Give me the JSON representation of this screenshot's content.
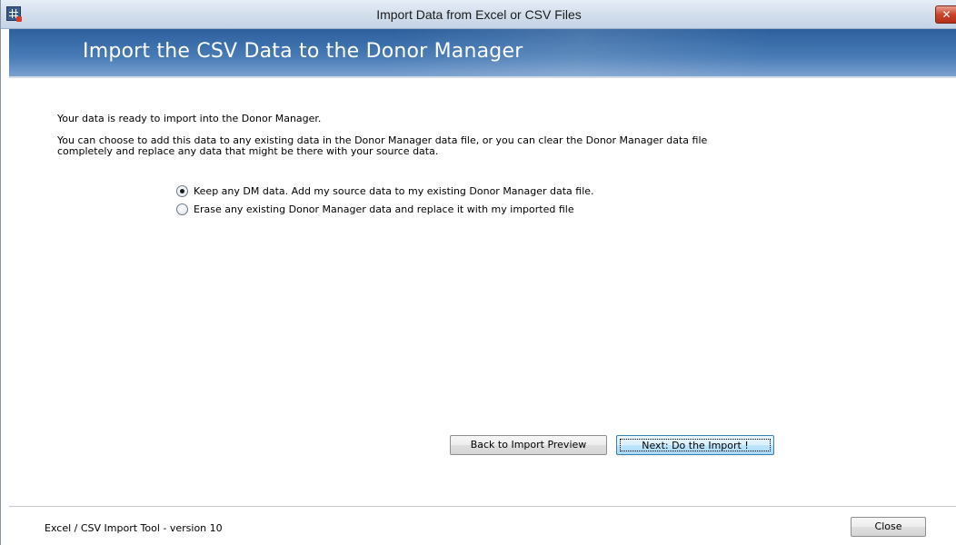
{
  "window": {
    "title": "Import Data from Excel or CSV Files",
    "close_glyph": "✕"
  },
  "header": {
    "title": "Import the CSV Data to the Donor Manager"
  },
  "main": {
    "intro": "Your data is ready to import into the Donor Manager.",
    "description": "You can choose to add this data to any existing data in the Donor Manager data file, or you can clear the Donor Manager data file completely and replace any data that might be there with your source data.",
    "options": [
      {
        "label": "Keep any DM data.  Add my source data to my existing Donor Manager data file.",
        "checked": true
      },
      {
        "label": "Erase any existing Donor Manager data and replace it with my imported file",
        "checked": false
      }
    ],
    "back_button": "Back to Import Preview",
    "next_button": "Next:  Do the Import !"
  },
  "footer": {
    "version_text": "Excel / CSV Import Tool - version 10",
    "close_button": "Close"
  },
  "colors": {
    "header_band": "#3a6eaa",
    "close_button_red": "#c9432b",
    "default_button_border": "#3c7fb1"
  },
  "icons": {
    "app": "spreadsheet-app-icon",
    "close": "close-icon"
  }
}
